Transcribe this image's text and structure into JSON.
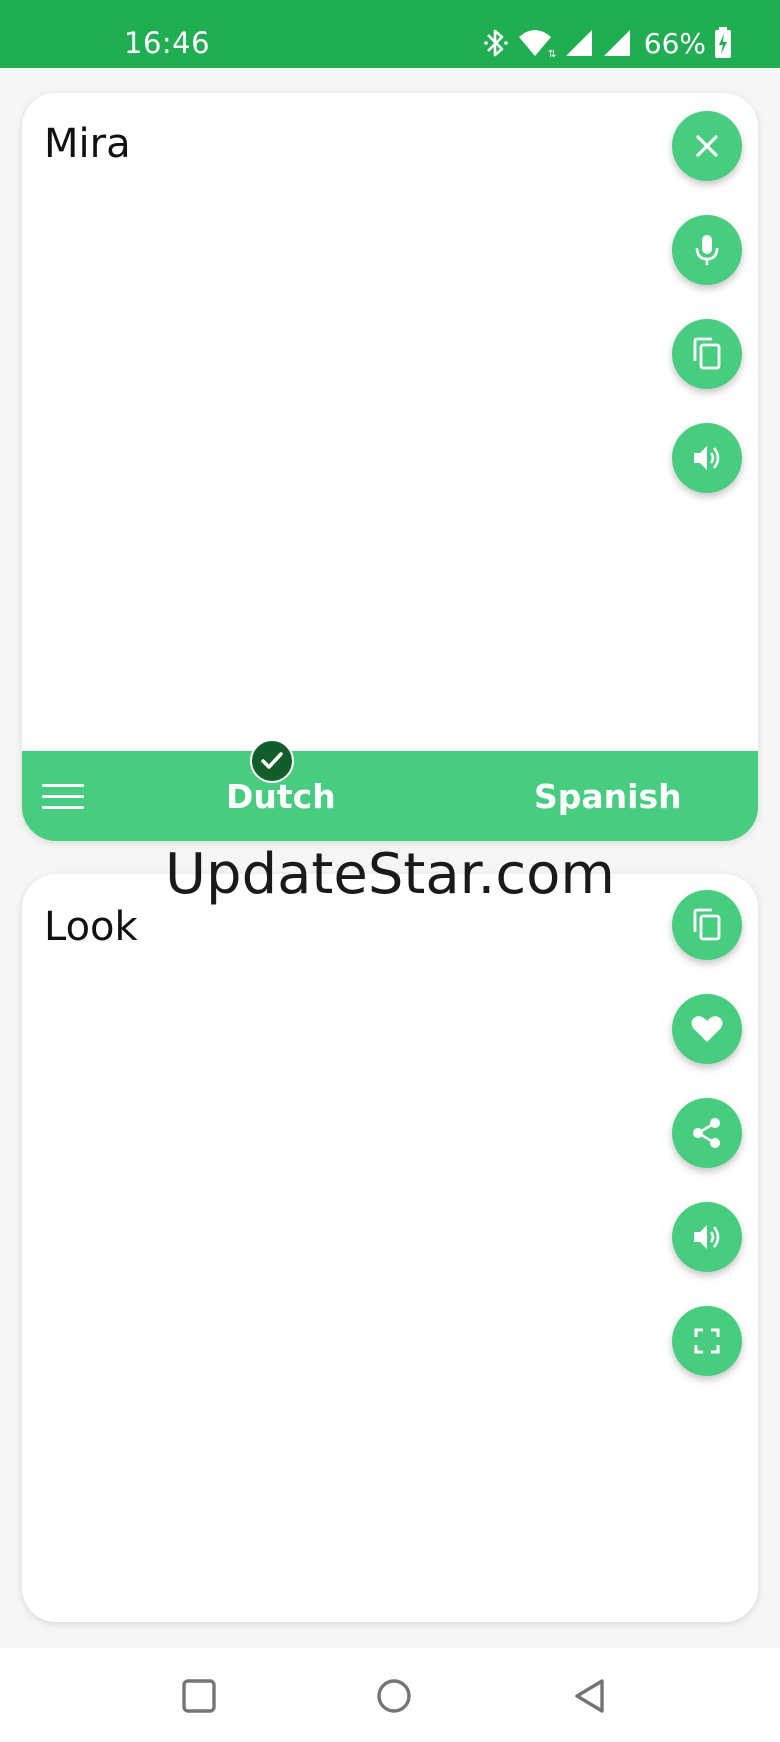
{
  "status_bar": {
    "time": "16:46",
    "battery_percent": "66%",
    "icons": [
      "bluetooth-icon",
      "wifi-icon",
      "signal-icon",
      "signal-icon",
      "battery-charging-icon"
    ]
  },
  "source_card": {
    "text": "Mira",
    "buttons": [
      "close-icon",
      "microphone-icon",
      "copy-icon",
      "speaker-icon"
    ]
  },
  "language_bar": {
    "source_language": "Dutch",
    "target_language": "Spanish",
    "selected": "source"
  },
  "watermark": {
    "text": "UpdateStar.com"
  },
  "target_card": {
    "text": "Look",
    "buttons": [
      "copy-icon",
      "heart-icon",
      "share-icon",
      "speaker-icon",
      "fullscreen-icon"
    ]
  },
  "nav_bar": {
    "buttons": [
      "recent-apps-icon",
      "home-icon",
      "back-icon"
    ]
  },
  "colors": {
    "status_bar": "#21ad52",
    "accent": "#48cd80",
    "check_badge": "#135c2c",
    "background": "#f6f6f6"
  }
}
